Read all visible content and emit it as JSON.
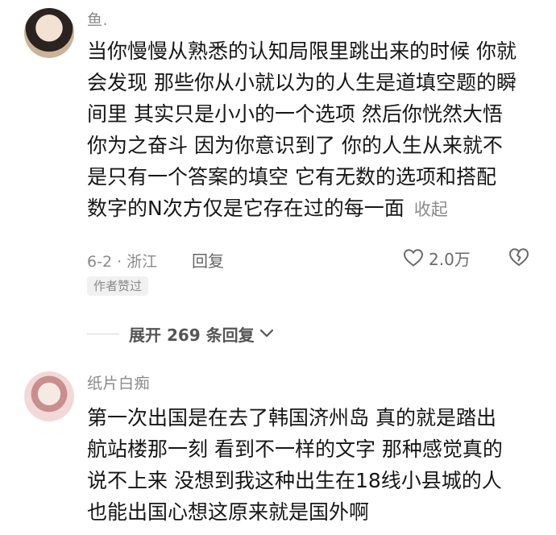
{
  "comments": [
    {
      "avatar_icon": "user-avatar",
      "username": "鱼.",
      "lines": [
        "当你慢慢从熟悉的认知局限里跳出来的时候 你就",
        "会发现 那些你从小就以为的人生是道填空题的瞬",
        "间里 其实只是小小的一个选项 然后你恍然大悟",
        "你为之奋斗 因为你意识到了 你的人生从来就不",
        "是只有一个答案的填空 它有无数的选项和搭配",
        "数字的N次方仅是它存在过的每一面"
      ],
      "collapse_label": "收起",
      "date_location": "6-2 · 浙江",
      "reply_label": "回复",
      "like_count": "2.0万",
      "author_badge": "作者赞过",
      "expand_replies_label": "展开 269 条回复"
    },
    {
      "avatar_icon": "user-avatar",
      "username": "纸片白痴",
      "lines": [
        "第一次出国是在去了韩国济州岛  真的就是踏出",
        "航站楼那一刻  看到不一样的文字  那种感觉真的",
        "说不上来  没想到我这种出生在18线小县城的人",
        "也能出国心想这原来就是国外啊"
      ]
    }
  ],
  "colors": {
    "text": "#161616",
    "muted": "#8a8a8a",
    "badge_bg": "#f1f1f1"
  }
}
